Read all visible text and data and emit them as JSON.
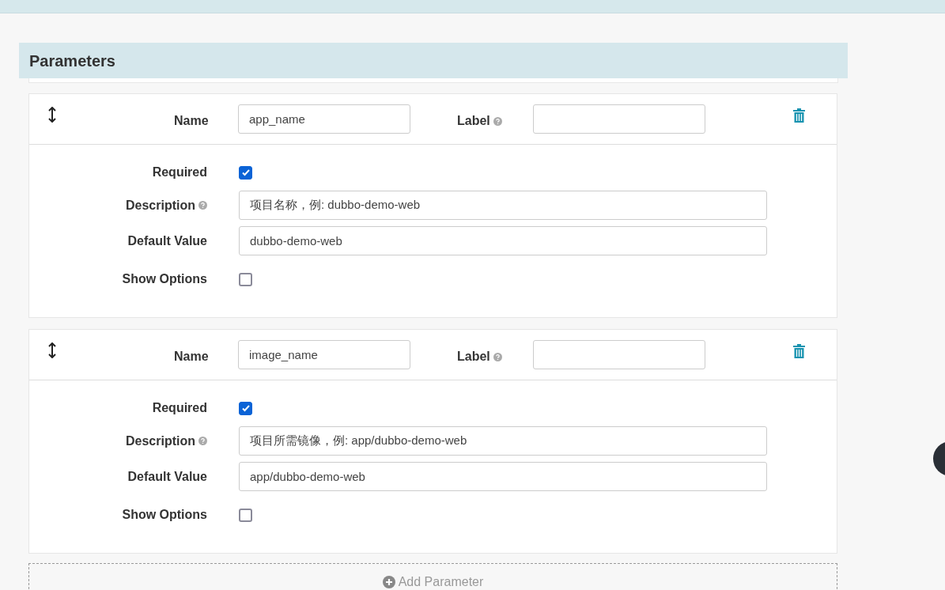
{
  "section": {
    "title": "Parameters"
  },
  "parameters": [
    {
      "name_label": "Name",
      "name_value": "app_name",
      "label_label": "Label",
      "required_label": "Required",
      "required": true,
      "description_label": "Description",
      "description_value": "项目名称，例: dubbo-demo-web",
      "default_label": "Default Value",
      "default_value": "dubbo-demo-web",
      "options_label": "Show Options",
      "show_options": false
    },
    {
      "name_label": "Name",
      "name_value": "image_name",
      "label_label": "Label",
      "required_label": "Required",
      "required": true,
      "description_label": "Description",
      "description_value": "项目所需镜像，例: app/dubbo-demo-web",
      "default_label": "Default Value",
      "default_value": "app/dubbo-demo-web",
      "options_label": "Show Options",
      "show_options": false
    }
  ],
  "add_button": "Add Parameter"
}
